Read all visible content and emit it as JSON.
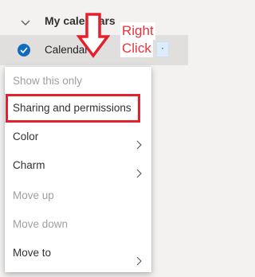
{
  "section": {
    "title": "My calendars"
  },
  "calendar": {
    "name": "Calendar",
    "more": "·"
  },
  "annotation": {
    "line1": "Right",
    "line2": "Click",
    "color": "#e8343a"
  },
  "menu": {
    "items": [
      {
        "label": "Show this only",
        "enabled": false,
        "submenu": false
      },
      {
        "label": "Sharing and permissions",
        "enabled": true,
        "submenu": false,
        "highlighted": true
      },
      {
        "label": "Color",
        "enabled": true,
        "submenu": true
      },
      {
        "label": "Charm",
        "enabled": true,
        "submenu": true
      },
      {
        "label": "Move up",
        "enabled": false,
        "submenu": false
      },
      {
        "label": "Move down",
        "enabled": false,
        "submenu": false
      },
      {
        "label": "Move to",
        "enabled": true,
        "submenu": true
      }
    ]
  },
  "colors": {
    "accent": "#0f6cbd",
    "highlight": "#e5202c"
  }
}
